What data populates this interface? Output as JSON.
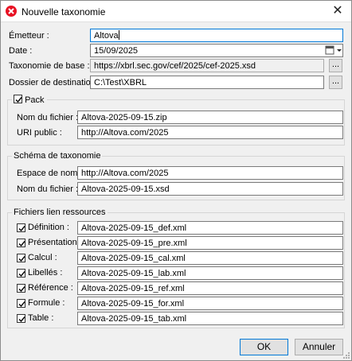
{
  "window": {
    "title": "Nouvelle taxonomie"
  },
  "form": {
    "emetteur": {
      "label": "Émetteur :",
      "value": "Altova"
    },
    "date": {
      "label": "Date :",
      "value": "15/09/2025"
    },
    "taxonomie_base": {
      "label": "Taxonomie de base :",
      "value": "https://xbrl.sec.gov/cef/2025/cef-2025.xsd"
    },
    "dossier": {
      "label": "Dossier de destination :",
      "value": "C:\\Test\\XBRL"
    },
    "browse_label": "..."
  },
  "pack": {
    "label": "Pack",
    "checked": true,
    "nom_fichier": {
      "label": "Nom du fichier :",
      "value": "Altova-2025-09-15.zip"
    },
    "uri_public": {
      "label": "URI public :",
      "value": "http://Altova.com/2025"
    }
  },
  "schema": {
    "title": "Schéma de taxonomie",
    "espace_noms": {
      "label": "Espace de noms :",
      "value": "http://Altova.com/2025"
    },
    "nom_fichier": {
      "label": "Nom du fichier :",
      "value": "Altova-2025-09-15.xsd"
    }
  },
  "linkbases": {
    "title": "Fichiers lien ressources",
    "items": [
      {
        "label": "Définition :",
        "value": "Altova-2025-09-15_def.xml",
        "checked": true
      },
      {
        "label": "Présentation :",
        "value": "Altova-2025-09-15_pre.xml",
        "checked": true
      },
      {
        "label": "Calcul :",
        "value": "Altova-2025-09-15_cal.xml",
        "checked": true
      },
      {
        "label": "Libellés :",
        "value": "Altova-2025-09-15_lab.xml",
        "checked": true
      },
      {
        "label": "Référence :",
        "value": "Altova-2025-09-15_ref.xml",
        "checked": true
      },
      {
        "label": "Formule :",
        "value": "Altova-2025-09-15_for.xml",
        "checked": true
      },
      {
        "label": "Table :",
        "value": "Altova-2025-09-15_tab.xml",
        "checked": true
      }
    ]
  },
  "buttons": {
    "ok": "OK",
    "cancel": "Annuler"
  },
  "colors": {
    "accent": "#0078d7",
    "app_icon": "#e81123"
  }
}
